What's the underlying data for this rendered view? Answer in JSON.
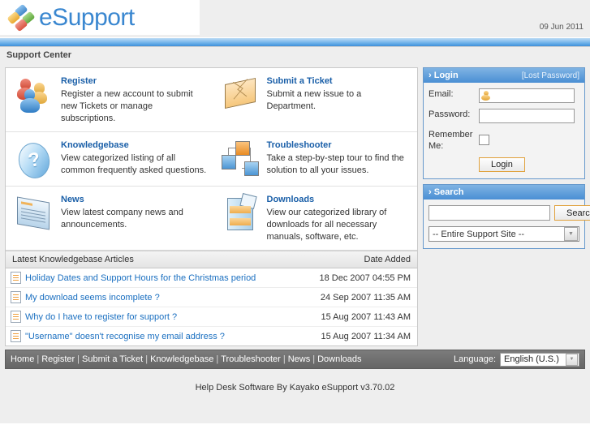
{
  "header": {
    "logo_text": "eSupport",
    "date": "09 Jun 2011",
    "breadcrumb": "Support Center"
  },
  "cards": [
    {
      "title": "Register",
      "desc": "Register a new account to submit new Tickets or manage subscriptions.",
      "icon": "people-icon"
    },
    {
      "title": "Submit a Ticket",
      "desc": "Submit a new issue to a Department.",
      "icon": "envelope-icon"
    },
    {
      "title": "Knowledgebase",
      "desc": "View categorized listing of all common frequently asked questions.",
      "icon": "question-mark-icon"
    },
    {
      "title": "Troubleshooter",
      "desc": "Take a step-by-step tour to find the solution to all your issues.",
      "icon": "network-cubes-icon"
    },
    {
      "title": "News",
      "desc": "View latest company news and announcements.",
      "icon": "newspaper-icon"
    },
    {
      "title": "Downloads",
      "desc": "View our categorized library of downloads for all necessary manuals, software, etc.",
      "icon": "download-box-icon"
    }
  ],
  "kb": {
    "col_title": "Latest Knowledgebase Articles",
    "col_date": "Date Added",
    "rows": [
      {
        "title": "Holiday Dates and Support Hours for the Christmas period",
        "date": "18 Dec 2007 04:55 PM"
      },
      {
        "title": "My download seems incomplete ?",
        "date": "24 Sep 2007 11:35 AM"
      },
      {
        "title": "Why do I have to register for support ?",
        "date": "15 Aug 2007 11:43 AM"
      },
      {
        "title": "\"Username\" doesn't recognise my email address ?",
        "date": "15 Aug 2007 11:34 AM"
      }
    ]
  },
  "login": {
    "title": "Login",
    "lost_password": "[Lost Password]",
    "email_label": "Email:",
    "email_value": "",
    "password_label": "Password:",
    "password_value": "",
    "remember_label": "Remember Me:",
    "button": "Login"
  },
  "search": {
    "title": "Search",
    "query": "",
    "button": "Search",
    "scope_selected": "-- Entire Support Site --"
  },
  "footer": {
    "links": [
      "Home",
      "Register",
      "Submit a Ticket",
      "Knowledgebase",
      "Troubleshooter",
      "News",
      "Downloads"
    ],
    "separator": "|",
    "language_label": "Language:",
    "language_selected": "English (U.S.)",
    "copyright": "Help Desk Software By Kayako eSupport v3.70.02"
  },
  "colors": {
    "accent_blue": "#3a87d0",
    "link_blue": "#1a6fc0",
    "panel_border": "#6699cc",
    "button_border": "#e0a13c"
  }
}
